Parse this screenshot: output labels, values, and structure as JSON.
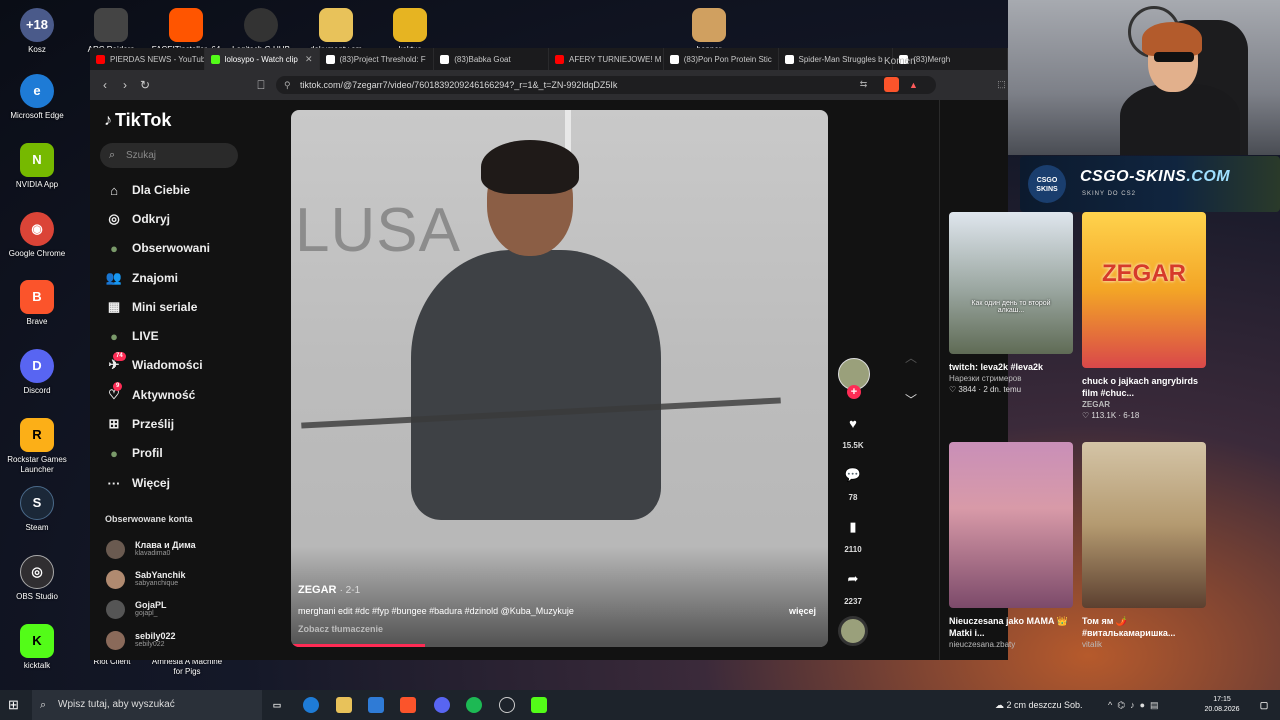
{
  "desktop": {
    "icons": [
      {
        "label": "Kosz",
        "icon": "recycle-bin-icon",
        "glyph": "+18",
        "color": "#4a5a8a"
      },
      {
        "label": "Microsoft Edge",
        "icon": "edge-icon",
        "glyph": "e",
        "color": "#1e7bd6"
      },
      {
        "label": "NVIDIA App",
        "icon": "nvidia-icon",
        "glyph": "N",
        "color": "#76b900"
      },
      {
        "label": "Google Chrome",
        "icon": "chrome-icon",
        "glyph": "◉",
        "color": "#db4437"
      },
      {
        "label": "Brave",
        "icon": "brave-icon",
        "glyph": "B",
        "color": "#fb542b"
      },
      {
        "label": "Discord",
        "icon": "discord-icon",
        "glyph": "D",
        "color": "#5865f2"
      },
      {
        "label": "Rockstar Games Launcher",
        "icon": "rockstar-icon",
        "glyph": "R",
        "color": "#fcaf17"
      },
      {
        "label": "Steam",
        "icon": "steam-icon",
        "glyph": "S",
        "color": "#1b2838"
      },
      {
        "label": "OBS Studio",
        "icon": "obs-icon",
        "glyph": "◎",
        "color": "#302e31"
      },
      {
        "label": "kicktalk",
        "icon": "kicktalk-icon",
        "glyph": "K",
        "color": "#53fc18"
      }
    ],
    "top_icons": [
      {
        "label": "ARC Raiders",
        "icon": "arc-raiders-icon",
        "color": "#444"
      },
      {
        "label": "FACEITinstaller_64",
        "icon": "faceit-icon",
        "color": "#ff5500"
      },
      {
        "label": "Logitech G HUB",
        "icon": "logitech-icon",
        "color": "#333"
      },
      {
        "label": "dokumenty sm",
        "icon": "folder-icon",
        "color": "#e8c25a"
      },
      {
        "label": "kaktus",
        "icon": "file-icon",
        "color": "#e6b422"
      },
      {
        "label": "banner",
        "icon": "banner-icon",
        "color": "#d0a060"
      }
    ],
    "other_labels": {
      "riot": "Riot Client",
      "amnesia": "Amnesia A Machine for Pigs"
    }
  },
  "browser": {
    "tabs": [
      {
        "label": "PIERDAS NEWS - YouTub",
        "color": "#ff0000",
        "active": false
      },
      {
        "label": "lolosypo - Watch clip",
        "color": "#53fc18",
        "active": true
      },
      {
        "label": "(83)Project Threshold: F",
        "color": "#ffffff",
        "active": false
      },
      {
        "label": "(83)Babka Goat",
        "color": "#ffffff",
        "active": false
      },
      {
        "label": "AFERY TURNIEJOWE! M",
        "color": "#ff0000",
        "active": false
      },
      {
        "label": "(83)Pon Pon Protein Stic",
        "color": "#ffffff",
        "active": false
      },
      {
        "label": "Spider-Man Struggles b",
        "color": "#ffffff",
        "active": false
      },
      {
        "label": "(83)Mergh",
        "color": "#ffffff",
        "active": false
      }
    ],
    "url": "tiktok.com/@7zegarr7/video/7601839209246166294?_r=1&_t=ZN-992ldqDZ5Ik"
  },
  "tiktok": {
    "brand": "TikTok",
    "search_placeholder": "Szukaj",
    "nav": [
      {
        "label": "Dla Ciebie",
        "icon": "home-icon",
        "glyph": "⌂"
      },
      {
        "label": "Odkryj",
        "icon": "compass-icon",
        "glyph": "◎"
      },
      {
        "label": "Obserwowani",
        "icon": "following-avatar-icon",
        "glyph": "●"
      },
      {
        "label": "Znajomi",
        "icon": "friends-icon",
        "glyph": "👥"
      },
      {
        "label": "Mini seriale",
        "icon": "mini-series-icon",
        "glyph": "▦"
      },
      {
        "label": "LIVE",
        "icon": "live-icon",
        "glyph": "●"
      },
      {
        "label": "Wiadomości",
        "icon": "messages-icon",
        "glyph": "✈",
        "badge": "74"
      },
      {
        "label": "Aktywność",
        "icon": "activity-icon",
        "glyph": "♡",
        "badge": "9"
      },
      {
        "label": "Prześlij",
        "icon": "upload-icon",
        "glyph": "⊞"
      },
      {
        "label": "Profil",
        "icon": "profile-avatar-icon",
        "glyph": "●"
      },
      {
        "label": "Więcej",
        "icon": "more-icon",
        "glyph": "···"
      }
    ],
    "following_title": "Obserwowane konta",
    "following": [
      {
        "name": "Клава и Дима",
        "handle": "klavadima0"
      },
      {
        "name": "SabYanchik",
        "handle": "sabyanchique"
      },
      {
        "name": "GojaPL",
        "handle": "gojapl_"
      },
      {
        "name": "sebily022",
        "handle": "sebily022"
      }
    ],
    "video": {
      "overlay_text": "LUSA",
      "author": "ZEGAR",
      "date": "· 2-1",
      "caption": "merghani edit #dc #fyp #bungee #badura #dzinold @Kuba_Muzykuje",
      "translate": "Zobacz tłumaczenie",
      "more": "więcej",
      "progress": 0.25
    },
    "actions": {
      "likes": "15.5K",
      "comments": "78",
      "saves": "2110",
      "shares": "2237"
    },
    "comments_tab": "Komen",
    "related": [
      {
        "title": "twitch: leva2k #leva2k",
        "author": "Нарезки стримеров",
        "stats": "3844 · 2 dn. temu",
        "thumb_text": "Как один день то второй алкаш..."
      },
      {
        "title": "chuck o jajkach angrybirds film #chuc...",
        "author": "ZEGAR",
        "stats": "113.1K · 6-18",
        "thumb_text": "ZEGAR"
      },
      {
        "title": "Nieuczesana jako MAMA 👑 Matki i...",
        "author": "nieuczesana.zbaty",
        "stats": "",
        "thumb_text": ""
      },
      {
        "title": "Том ям 🌶️ #виталькамаришка...",
        "author": "vitalik",
        "stats": "",
        "thumb_text": ""
      }
    ]
  },
  "overlay": {
    "sponsor_logo": "CSGO SKINS",
    "sponsor_name_main": "CSGO-SKINS",
    "sponsor_name_tld": ".COM",
    "sponsor_sub": "SKINY DO CS2"
  },
  "taskbar": {
    "search_placeholder": "Wpisz tutaj, aby wyszukać",
    "weather": "2 cm deszczu Sob.",
    "time": "17:15",
    "date": "20.08.2026"
  }
}
